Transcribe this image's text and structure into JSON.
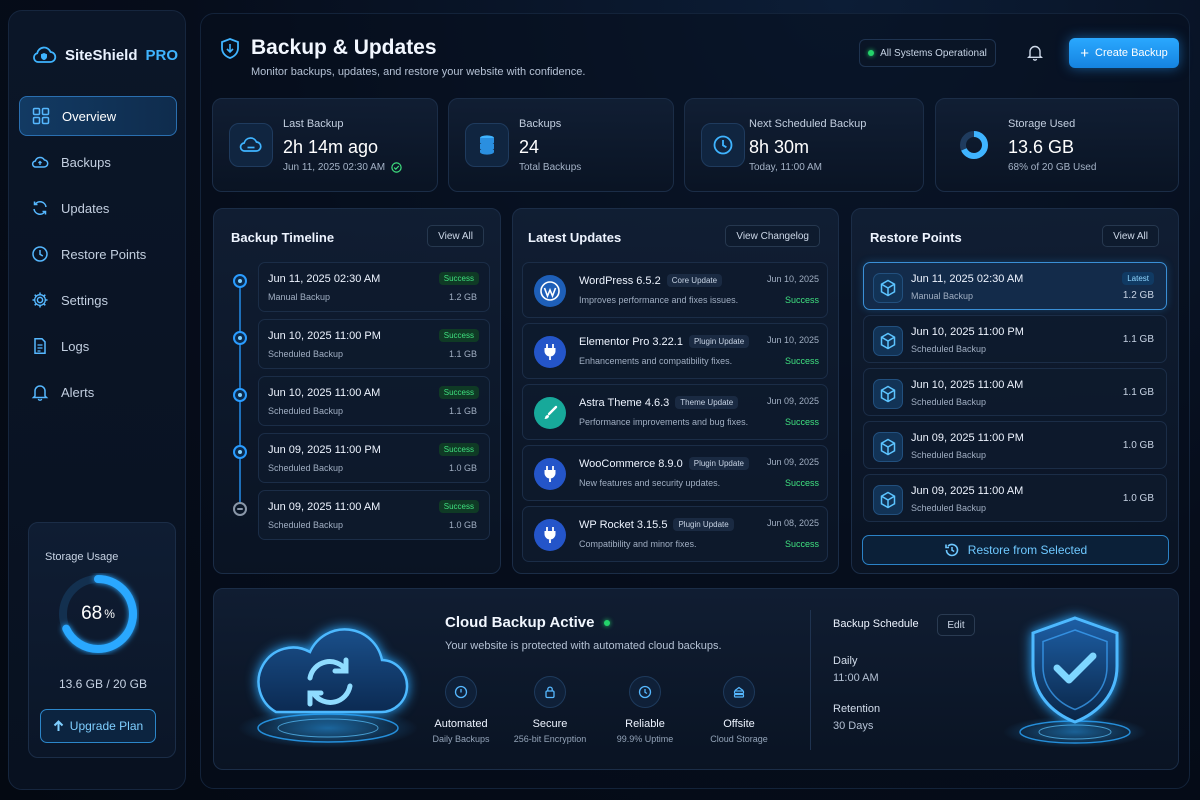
{
  "brand": {
    "name": "SiteShield",
    "suffix": "PRO"
  },
  "nav": [
    {
      "label": "Overview",
      "icon": "grid-icon"
    },
    {
      "label": "Backups",
      "icon": "cloud-icon"
    },
    {
      "label": "Updates",
      "icon": "refresh-icon"
    },
    {
      "label": "Restore Points",
      "icon": "clock-icon"
    },
    {
      "label": "Settings",
      "icon": "gear-icon"
    },
    {
      "label": "Logs",
      "icon": "document-icon"
    },
    {
      "label": "Alerts",
      "icon": "bell-icon"
    }
  ],
  "storage": {
    "label": "Storage Usage",
    "percent": "68",
    "percent_sign": "%",
    "fraction": 0.68,
    "amount": "13.6 GB / 20 GB",
    "upgrade": "Upgrade Plan"
  },
  "header": {
    "title": "Backup & Updates",
    "subtitle": "Monitor backups, updates, and restore your website with confidence.",
    "status": "All Systems Operational",
    "create": "Create Backup"
  },
  "stats": [
    {
      "label": "Last Backup",
      "value": "2h 14m ago",
      "detail": "Jun 11, 2025 02:30 AM"
    },
    {
      "label": "Backups",
      "value": "24",
      "detail": "Total Backups"
    },
    {
      "label": "Next Scheduled Backup",
      "value": "8h 30m",
      "detail": "Today, 11:00 AM"
    },
    {
      "label": "Storage Used",
      "value": "13.6 GB",
      "detail": "68% of 20 GB Used"
    }
  ],
  "timeline": {
    "title": "Backup Timeline",
    "action": "View All",
    "items": [
      {
        "date": "Jun 11, 2025 02:30 AM",
        "type": "Manual Backup",
        "status": "Success",
        "size": "1.2 GB"
      },
      {
        "date": "Jun 10, 2025 11:00 PM",
        "type": "Scheduled Backup",
        "status": "Success",
        "size": "1.1 GB"
      },
      {
        "date": "Jun 10, 2025 11:00 AM",
        "type": "Scheduled Backup",
        "status": "Success",
        "size": "1.1 GB"
      },
      {
        "date": "Jun 09, 2025 11:00 PM",
        "type": "Scheduled Backup",
        "status": "Success",
        "size": "1.0 GB"
      },
      {
        "date": "Jun 09, 2025 11:00 AM",
        "type": "Scheduled Backup",
        "status": "Success",
        "size": "1.0 GB"
      }
    ]
  },
  "updates": {
    "title": "Latest Updates",
    "action": "View Changelog",
    "items": [
      {
        "name": "WordPress 6.5.2",
        "tag": "Core Update",
        "desc": "Improves performance and fixes issues.",
        "date": "Jun 10, 2025",
        "status": "Success",
        "icon": "wordpress-icon",
        "color": "#1e5fb8"
      },
      {
        "name": "Elementor Pro 3.22.1",
        "tag": "Plugin Update",
        "desc": "Enhancements and compatibility fixes.",
        "date": "Jun 10, 2025",
        "status": "Success",
        "icon": "plug-icon",
        "color": "#2455c9"
      },
      {
        "name": "Astra Theme 4.6.3",
        "tag": "Theme Update",
        "desc": "Performance improvements and bug fixes.",
        "date": "Jun 09, 2025",
        "status": "Success",
        "icon": "brush-icon",
        "color": "#17a99a"
      },
      {
        "name": "WooCommerce 8.9.0",
        "tag": "Plugin Update",
        "desc": "New features and security updates.",
        "date": "Jun 09, 2025",
        "status": "Success",
        "icon": "plug-icon",
        "color": "#2455c9"
      },
      {
        "name": "WP Rocket 3.15.5",
        "tag": "Plugin Update",
        "desc": "Compatibility and minor fixes.",
        "date": "Jun 08, 2025",
        "status": "Success",
        "icon": "plug-icon",
        "color": "#2455c9"
      }
    ]
  },
  "restore": {
    "title": "Restore Points",
    "action": "View All",
    "button": "Restore from Selected",
    "items": [
      {
        "date": "Jun 11, 2025 02:30 AM",
        "type": "Manual Backup",
        "size": "1.2 GB",
        "badge": "Latest"
      },
      {
        "date": "Jun 10, 2025 11:00 PM",
        "type": "Scheduled Backup",
        "size": "1.1 GB"
      },
      {
        "date": "Jun 10, 2025 11:00 AM",
        "type": "Scheduled Backup",
        "size": "1.1 GB"
      },
      {
        "date": "Jun 09, 2025 11:00 PM",
        "type": "Scheduled Backup",
        "size": "1.0 GB"
      },
      {
        "date": "Jun 09, 2025 11:00 AM",
        "type": "Scheduled Backup",
        "size": "1.0 GB"
      }
    ]
  },
  "cloud": {
    "title": "Cloud Backup Active",
    "subtitle": "Your website is protected with automated cloud backups.",
    "features": [
      {
        "title": "Automated",
        "detail": "Daily Backups",
        "icon": "power-icon"
      },
      {
        "title": "Secure",
        "detail": "256-bit Encryption",
        "icon": "lock-icon"
      },
      {
        "title": "Reliable",
        "detail": "99.9% Uptime",
        "icon": "clock-icon"
      },
      {
        "title": "Offsite",
        "detail": "Cloud Storage",
        "icon": "server-icon"
      }
    ]
  },
  "schedule": {
    "title": "Backup Schedule",
    "edit": "Edit",
    "frequency": "Daily",
    "time": "11:00 AM",
    "retention_label": "Retention",
    "retention": "30 Days"
  },
  "colors": {
    "accent": "#2aa8ff",
    "success": "#3fe07f",
    "background": "#050b16"
  }
}
